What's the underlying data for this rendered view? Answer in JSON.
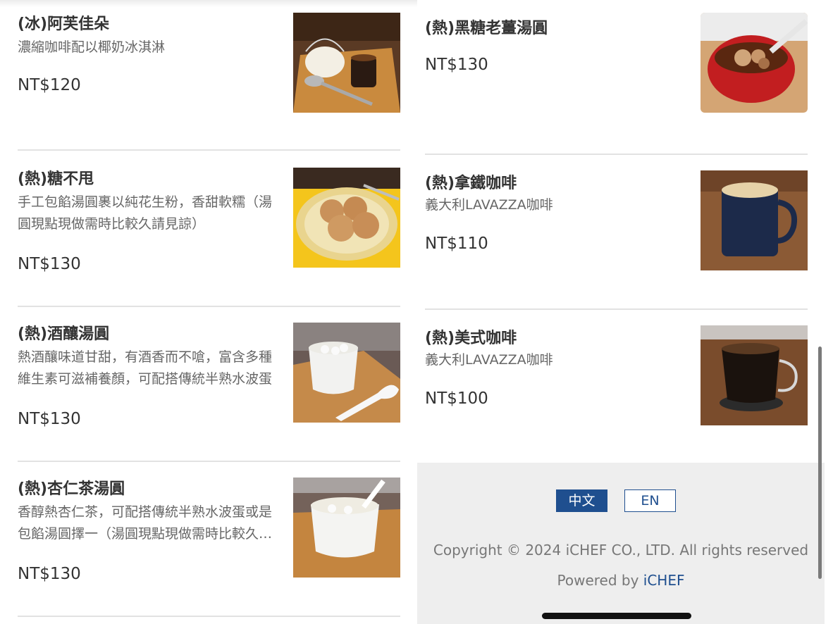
{
  "menu": {
    "left": [
      {
        "name": "(冰)阿芙佳朵",
        "desc": "濃縮咖啡配以椰奶冰淇淋",
        "price": "NT$120",
        "photo": "affogato-photo"
      },
      {
        "name": "(熱)糖不甩",
        "desc": "手工包餡湯圓裹以純花生粉，香甜軟糯（湯圓現點現做需時比較久請見諒）",
        "price": "NT$130",
        "photo": "peanut-dumplings-photo"
      },
      {
        "name": "(熱)酒釀湯圓",
        "desc": "熱酒釀味道甘甜，有酒香而不嗆，富含多種維生素可滋補養顏，可配搭傳統半熟水波蛋",
        "price": "NT$130",
        "photo": "rice-wine-dumplings-photo"
      },
      {
        "name": "(熱)杏仁茶湯圓",
        "desc": "香醇熱杏仁茶，可配搭傳統半熟水波蛋或是包餡湯圓擇一（湯圓現點現做需時比較久請見諒）",
        "price": "NT$130",
        "photo": "almond-tea-dumplings-photo"
      }
    ],
    "right": [
      {
        "name": "(熱)黑糖老薑湯圓",
        "desc": "",
        "price": "NT$130",
        "photo": "brown-sugar-ginger-dumplings-photo"
      },
      {
        "name": "(熱)拿鐵咖啡",
        "desc": "義大利LAVAZZA咖啡",
        "price": "NT$110",
        "photo": "latte-photo"
      },
      {
        "name": "(熱)美式咖啡",
        "desc": "義大利LAVAZZA咖啡",
        "price": "NT$100",
        "photo": "americano-photo"
      }
    ]
  },
  "footer": {
    "lang_zh": "中文",
    "lang_en": "EN",
    "copyright": "Copyright © 2024 iCHEF CO., LTD. All rights reserved",
    "powered_prefix": "Powered by ",
    "powered_brand": "iCHEF"
  },
  "colors": {
    "accent": "#1f4f8f",
    "footer_bg": "#eeeeee",
    "divider": "#e2e2e2"
  }
}
